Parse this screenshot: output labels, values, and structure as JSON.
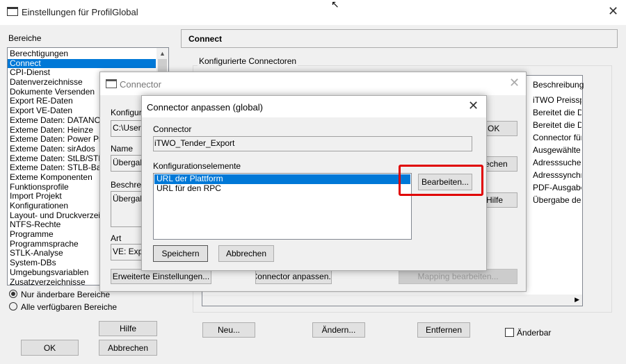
{
  "main": {
    "title": "Einstellungen für ProfilGlobal",
    "bereiche_label": "Bereiche",
    "items": [
      "Berechtigungen",
      "Connect",
      "CPI-Dienst",
      "Datenverzeichnisse",
      "Dokumente Versenden",
      "Export RE-Daten",
      "Export VE-Daten",
      "Exteme Daten: DATANORM",
      "Exteme Daten: Heinze",
      "Exteme Daten: Power Project",
      "Exteme Daten: sirAdos",
      "Exteme Daten: StLB/STLK",
      "Exteme Daten: STLB-Bau",
      "Exteme Komponenten",
      "Funktionsprofile",
      "Import Projekt",
      "Konfigurationen",
      "Layout- und Druckverzeichnisse",
      "NTFS-Rechte",
      "Programme",
      "Programmsprache",
      "STLK-Analyse",
      "System-DBs",
      "Umgebungsvariablen",
      "Zusatzverzeichnisse"
    ],
    "selected_item": "Connect",
    "radio_editable": "Nur änderbare Bereiche",
    "radio_all": "Alle verfügbaren Bereiche",
    "help": "Hilfe",
    "ok": "OK",
    "cancel": "Abbrechen"
  },
  "panel": {
    "header": "Connect",
    "group": "Konfigurierte Connectoren",
    "col_desc": "Beschreibung",
    "descriptions": [
      "iTWO Preisspi",
      "Bereitet die Da",
      "Bereitet die Da",
      "Connector für",
      "Ausgewählte E",
      "Adresssuche i",
      "Adresssynchro",
      "PDF-Ausgabe",
      "Übergabe der"
    ],
    "new": "Neu...",
    "change": "Ändern...",
    "remove": "Entfernen",
    "editable": "Änderbar"
  },
  "connector": {
    "title": "Connector",
    "konfig_label": "Konfigura",
    "konfig_value": "C:\\Users",
    "name_label": "Name",
    "name_value": "Übergab",
    "desc_label": "Beschrei",
    "desc_value": "Übergab",
    "art_label": "Art",
    "art_value": "VE: Exp",
    "ok": "OK",
    "cancel": "rechen",
    "help": "Hilfe",
    "advanced": "Erweiterte Einstellungen...",
    "customize": "Connector anpassen...",
    "mapping": "Mapping bearbeiten..."
  },
  "customize": {
    "title": "Connector anpassen (global)",
    "connector_label": "Connector",
    "connector_value": "iTWO_Tender_Export",
    "elements_label": "Konfigurationselemente",
    "elements": [
      "URL der Plattform",
      "URL für den RPC"
    ],
    "edit": "Bearbeiten...",
    "save": "Speichern",
    "cancel": "Abbrechen"
  },
  "colors": {
    "selection": "#0078d7",
    "highlight": "#e00000"
  }
}
